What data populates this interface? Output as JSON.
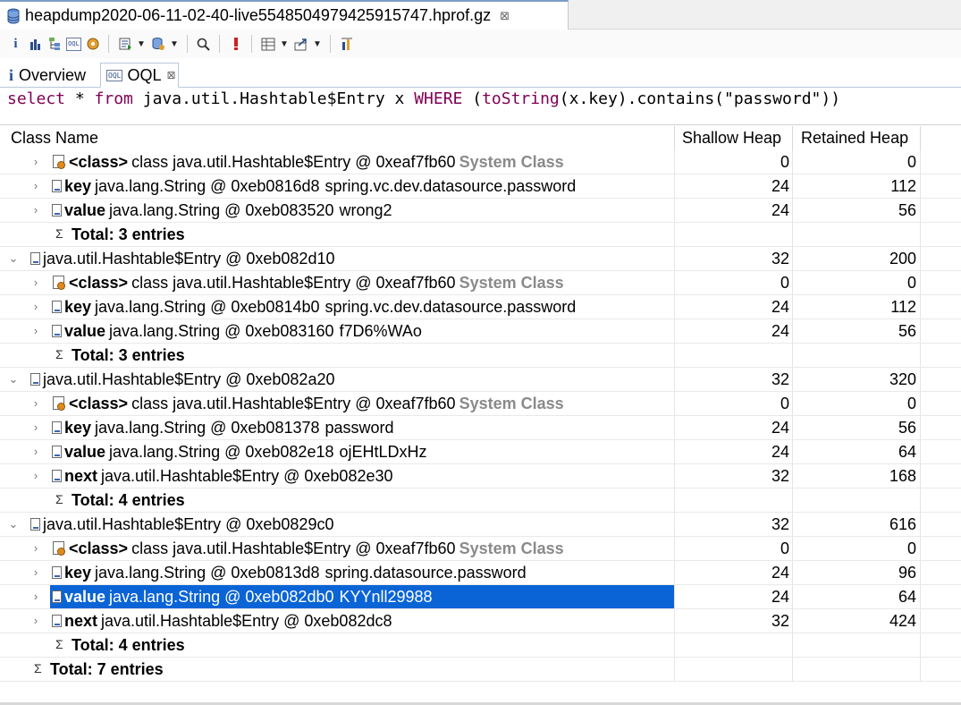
{
  "editor_tab": {
    "title": "heapdump2020-06-11-02-40-live5548504979425915747.hprof.gz",
    "close": "⊠"
  },
  "inner_tabs": {
    "overview": "Overview",
    "oql": "OQL",
    "oql_icon_text": "OQL",
    "close": "⊠"
  },
  "query": {
    "select": "select",
    "star": " * ",
    "from": "from",
    "cls": " java.util.Hashtable$Entry x ",
    "where": "WHERE",
    "p1": " (",
    "fn": "toString",
    "rest": "(x.key).contains(\"password\"))"
  },
  "columns": {
    "name": "Class Name",
    "shallow": "Shallow Heap",
    "retained": "Retained Heap"
  },
  "rows": [
    {
      "type": "child",
      "icon": "class",
      "label": "<class>",
      "text": "class java.util.Hashtable$Entry @ 0xeaf7fb60",
      "suffix": "System Class",
      "shallow": "0",
      "retained": "0"
    },
    {
      "type": "child",
      "icon": "doc",
      "label": "key",
      "text": "java.lang.String @ 0xeb0816d8",
      "value": "spring.vc.dev.datasource.password",
      "shallow": "24",
      "retained": "112"
    },
    {
      "type": "child",
      "icon": "doc",
      "label": "value",
      "text": "java.lang.String @ 0xeb083520",
      "value": "wrong2",
      "shallow": "24",
      "retained": "56"
    },
    {
      "type": "total",
      "label": "Total: 3 entries"
    },
    {
      "type": "parent",
      "icon": "doc",
      "text": "java.util.Hashtable$Entry @ 0xeb082d10",
      "shallow": "32",
      "retained": "200"
    },
    {
      "type": "child",
      "icon": "class",
      "label": "<class>",
      "text": "class java.util.Hashtable$Entry @ 0xeaf7fb60",
      "suffix": "System Class",
      "shallow": "0",
      "retained": "0"
    },
    {
      "type": "child",
      "icon": "doc",
      "label": "key",
      "text": "java.lang.String @ 0xeb0814b0",
      "value": "spring.vc.dev.datasource.password",
      "shallow": "24",
      "retained": "112"
    },
    {
      "type": "child",
      "icon": "doc",
      "label": "value",
      "text": "java.lang.String @ 0xeb083160",
      "value": "f7D6%WAo",
      "shallow": "24",
      "retained": "56"
    },
    {
      "type": "total",
      "label": "Total: 3 entries"
    },
    {
      "type": "parent",
      "icon": "doc",
      "text": "java.util.Hashtable$Entry @ 0xeb082a20",
      "shallow": "32",
      "retained": "320"
    },
    {
      "type": "child",
      "icon": "class",
      "label": "<class>",
      "text": "class java.util.Hashtable$Entry @ 0xeaf7fb60",
      "suffix": "System Class",
      "shallow": "0",
      "retained": "0"
    },
    {
      "type": "child",
      "icon": "doc",
      "label": "key",
      "text": "java.lang.String @ 0xeb081378",
      "value": "password",
      "shallow": "24",
      "retained": "56"
    },
    {
      "type": "child",
      "icon": "doc",
      "label": "value",
      "text": "java.lang.String @ 0xeb082e18",
      "value": "ojEHtLDxHz",
      "shallow": "24",
      "retained": "64"
    },
    {
      "type": "child",
      "icon": "doc",
      "label": "next",
      "text": "java.util.Hashtable$Entry @ 0xeb082e30",
      "shallow": "32",
      "retained": "168"
    },
    {
      "type": "total",
      "label": "Total: 4 entries"
    },
    {
      "type": "parent",
      "icon": "doc",
      "text": "java.util.Hashtable$Entry @ 0xeb0829c0",
      "shallow": "32",
      "retained": "616"
    },
    {
      "type": "child",
      "icon": "class",
      "label": "<class>",
      "text": "class java.util.Hashtable$Entry @ 0xeaf7fb60",
      "suffix": "System Class",
      "shallow": "0",
      "retained": "0"
    },
    {
      "type": "child",
      "icon": "doc",
      "label": "key",
      "text": "java.lang.String @ 0xeb0813d8",
      "value": "spring.datasource.password",
      "shallow": "24",
      "retained": "96"
    },
    {
      "type": "child",
      "icon": "doc",
      "label": "value",
      "text": "java.lang.String @ 0xeb082db0",
      "value": "KYYnll29988",
      "shallow": "24",
      "retained": "64",
      "selected": true
    },
    {
      "type": "child",
      "icon": "doc",
      "label": "next",
      "text": "java.util.Hashtable$Entry @ 0xeb082dc8",
      "shallow": "32",
      "retained": "424"
    },
    {
      "type": "total",
      "label": "Total: 4 entries"
    },
    {
      "type": "grand-total",
      "label": "Total: 7 entries"
    }
  ],
  "twisty_collapsed": "›",
  "twisty_expanded": "⌄",
  "sigma": "Σ"
}
